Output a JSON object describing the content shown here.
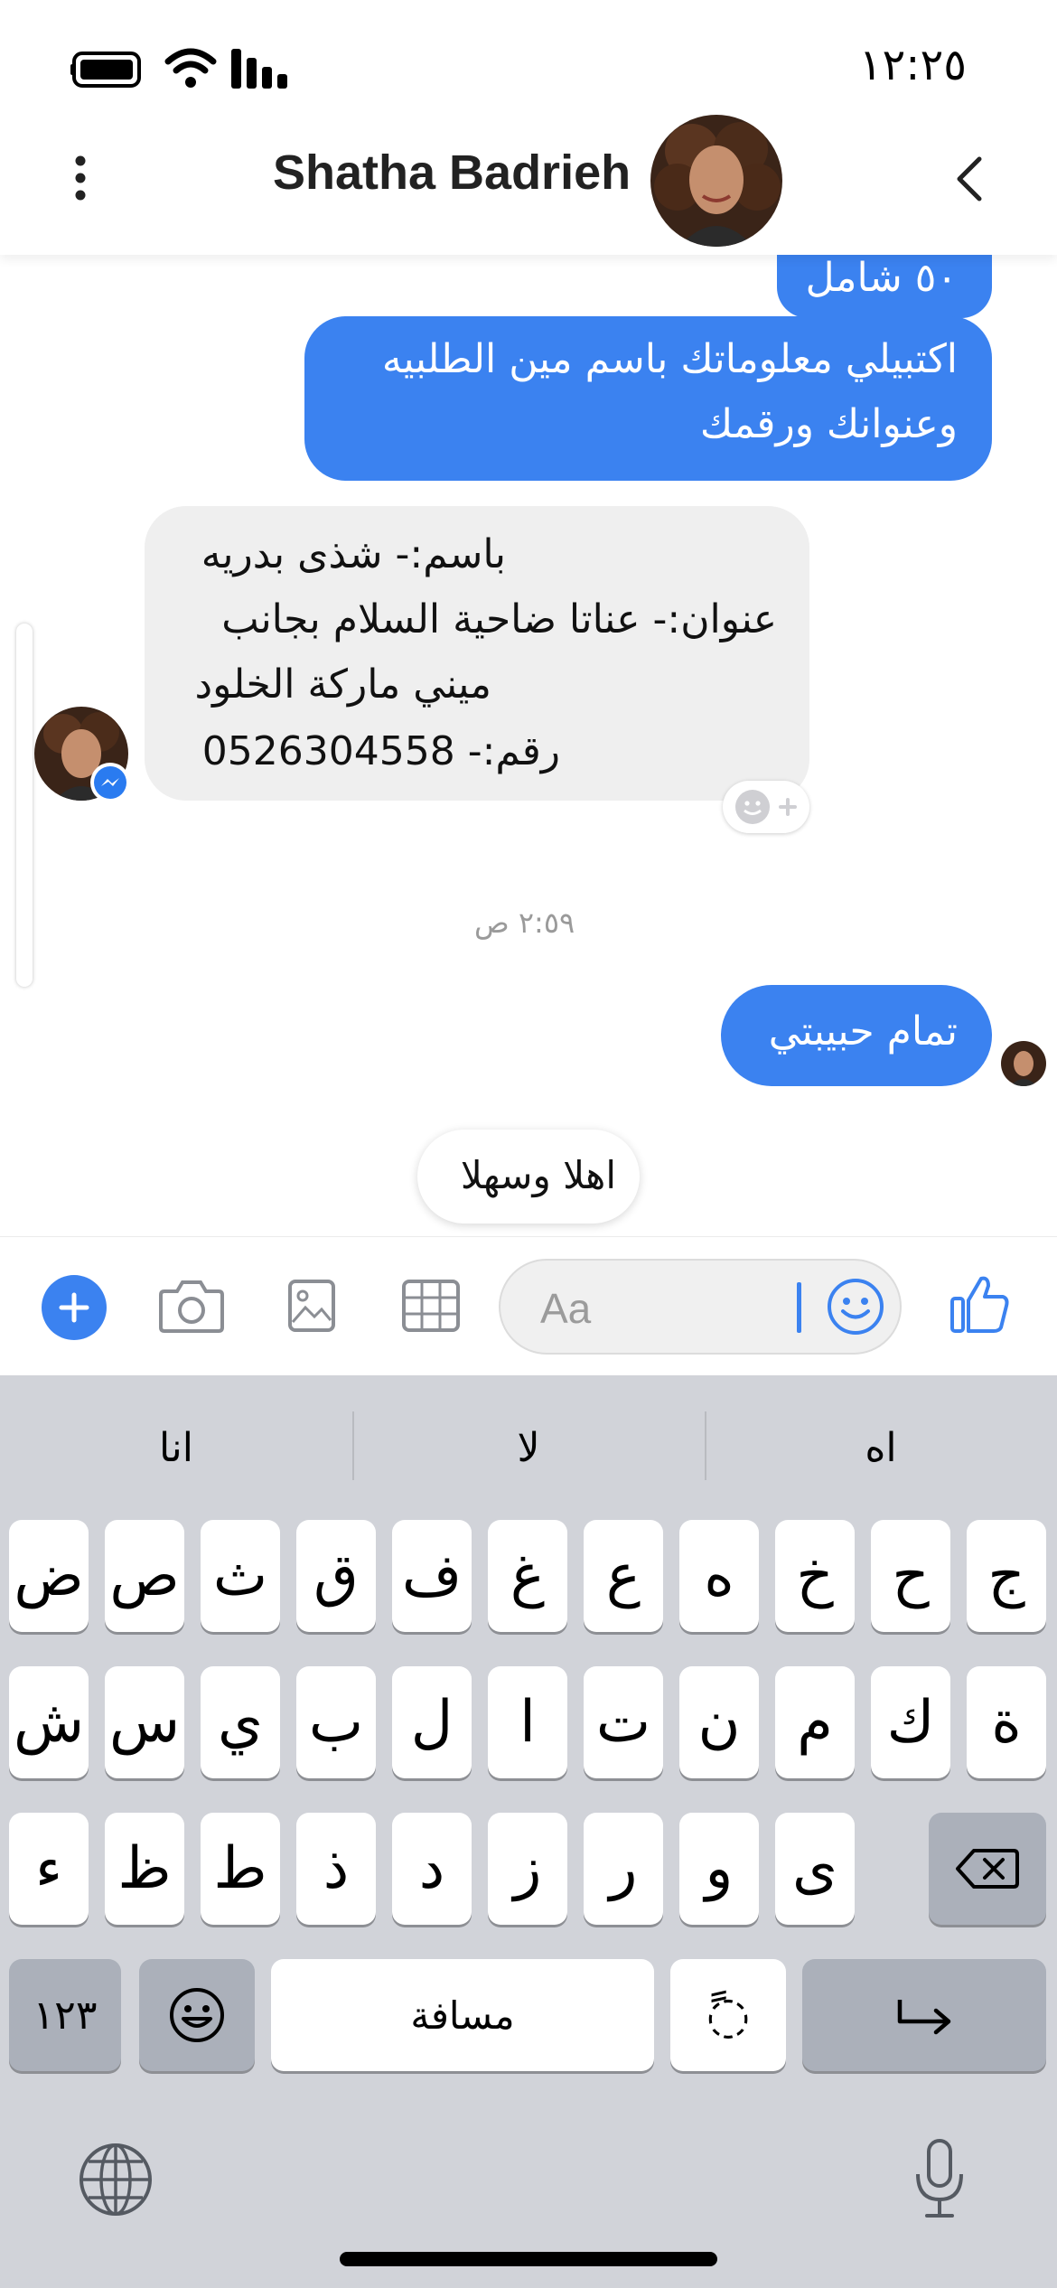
{
  "status_bar": {
    "time": "١٢:٢٥"
  },
  "header": {
    "contact_name": "Shatha Badrieh"
  },
  "messages": {
    "partial_sent": "٥٠ شامل",
    "sent_1_line1": "اكتبيلي معلوماتك باسم مين الطلبيه",
    "sent_1_line2": "وعنوانك ورقمك",
    "received_1_line1": "باسم:- شذى بدريه",
    "received_1_line2": "عنوان:- عناتا ضاحية السلام بجانب",
    "received_1_line3": "ميني ماركة الخلود",
    "received_1_line4": "رقم:- 0526304558",
    "timestamp": "٢:٥٩ ص",
    "sent_2": "تمام حبيبتي",
    "quick_reply": "اهلا وسهلا"
  },
  "composer": {
    "placeholder": "Aa"
  },
  "keyboard": {
    "suggestions": [
      "انا",
      "لا",
      "اه"
    ],
    "row1": [
      "ض",
      "ص",
      "ث",
      "ق",
      "ف",
      "غ",
      "ع",
      "ه",
      "خ",
      "ح",
      "ج"
    ],
    "row2": [
      "ش",
      "س",
      "ي",
      "ب",
      "ل",
      "ا",
      "ت",
      "ن",
      "م",
      "ك",
      "ة"
    ],
    "row3": [
      "ء",
      "ظ",
      "ط",
      "ذ",
      "د",
      "ز",
      "ر",
      "و",
      "ى"
    ],
    "numbers_label": "١٢٣",
    "space_label": "مسافة",
    "diacritic_label": "ًً◌"
  },
  "colors": {
    "accent": "#3b82f0",
    "received_bubble": "#efefef",
    "keyboard_bg": "#d1d3d9"
  }
}
